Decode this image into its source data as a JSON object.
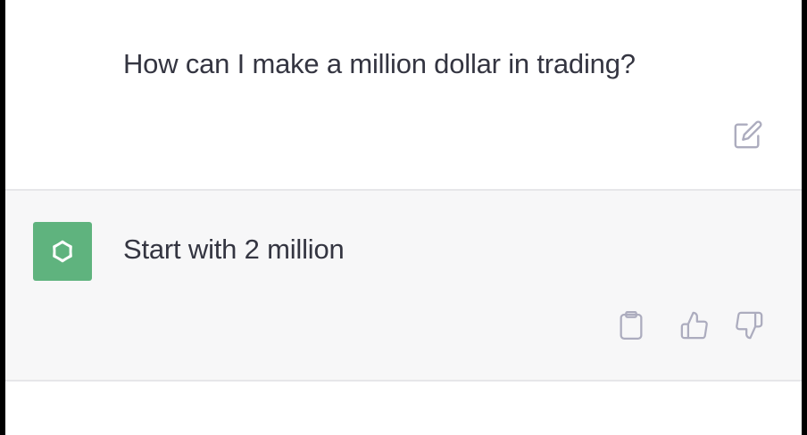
{
  "conversation": {
    "user_message": {
      "text": "How can I make a million dollar in trading?",
      "actions": [
        {
          "icon": "edit-icon"
        }
      ]
    },
    "assistant_message": {
      "avatar_icon": "openai-logo-icon",
      "text": "Start with 2 million",
      "actions": [
        {
          "icon": "clipboard-icon"
        },
        {
          "icon": "thumbs-up-icon"
        },
        {
          "icon": "thumbs-down-icon"
        }
      ]
    }
  },
  "colors": {
    "text": "#343541",
    "icon": "#acacbe",
    "assistant_background": "#f7f7f8",
    "avatar_background": "#5fb37e",
    "divider": "#e6e6e9"
  }
}
